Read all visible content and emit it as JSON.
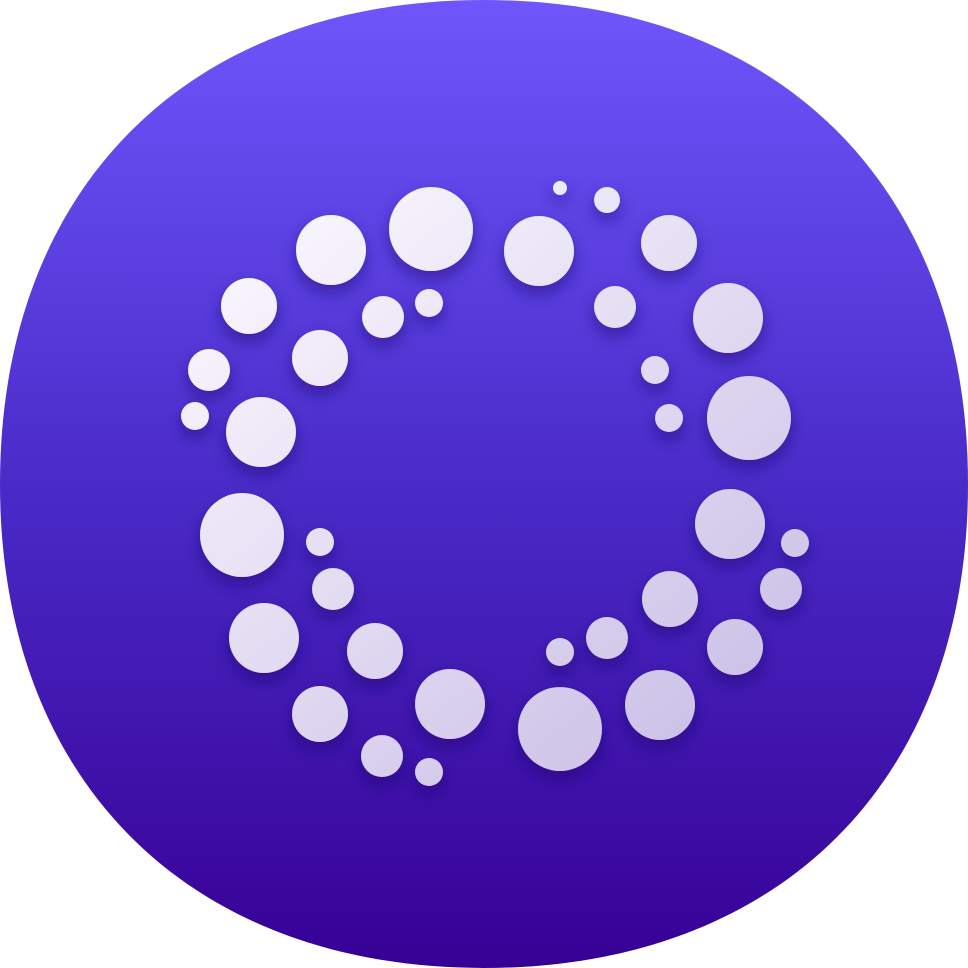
{
  "icon": {
    "semantic": "app-icon",
    "shape": "squircle",
    "glyph": "dotted-ring-icon"
  },
  "colors": {
    "gradient_top": "#6e56fc",
    "gradient_mid": "#4a2bc8",
    "gradient_bottom": "#370095",
    "dot_light": "#fbf9ff",
    "dot_shade": "#c8bde5"
  }
}
